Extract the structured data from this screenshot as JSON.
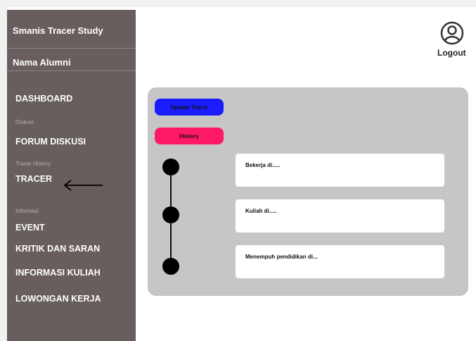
{
  "sidebar": {
    "title": "Smanis Tracer Study",
    "alumni_name": "Nama Alumni",
    "items": [
      {
        "label": "DASHBOARD"
      },
      {
        "section": "Diskusi",
        "label": "FORUM DISKUSI"
      },
      {
        "section": "Tracer History",
        "label": "TRACER"
      },
      {
        "section": "Informasi",
        "label": "EVENT"
      },
      {
        "label": "KRITIK DAN SARAN"
      },
      {
        "label": "INFORMASI KULIAH"
      },
      {
        "label": "LOWONGAN KERJA"
      }
    ]
  },
  "header": {
    "logout_label": "Logout",
    "avatar_icon": "user-avatar-icon"
  },
  "main": {
    "update_button": "Update Tracer",
    "history_button": "History",
    "timeline": [
      "Bekerja di.....",
      "Kuliah di.....",
      "Menempuh pendidikan di..."
    ]
  },
  "colors": {
    "sidebar_bg": "#675e5d",
    "panel_bg": "#c6c6c6",
    "update_button": "#1b1bff",
    "history_button": "#ff1a66"
  }
}
